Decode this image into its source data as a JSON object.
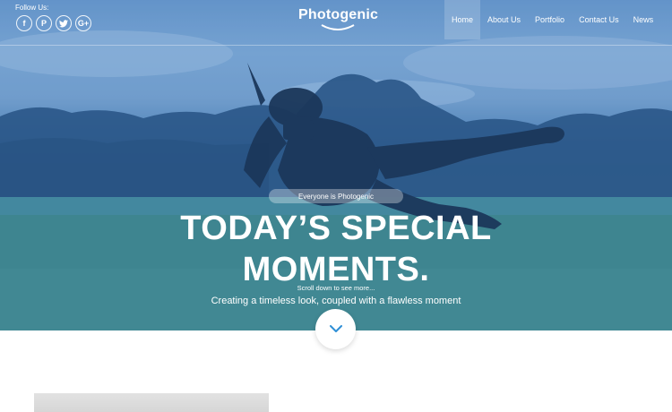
{
  "header": {
    "follow_label": "Follow Us:",
    "social": [
      {
        "glyph": "f",
        "icon": "facebook-icon"
      },
      {
        "glyph": "P",
        "icon": "pinterest-icon"
      },
      {
        "glyph": "t",
        "icon": "twitter-icon"
      },
      {
        "glyph": "G+",
        "icon": "google-plus-icon"
      }
    ],
    "brand": "Photogenic",
    "nav": [
      {
        "label": "Home",
        "active": true
      },
      {
        "label": "About Us",
        "active": false
      },
      {
        "label": "Portfolio",
        "active": false
      },
      {
        "label": "Contact Us",
        "active": false
      },
      {
        "label": "News",
        "active": false
      }
    ]
  },
  "hero": {
    "badge": "Everyone is Photogenic",
    "title_line1": "TODAY’S SPECIAL",
    "title_line2": "MOMENTS.",
    "scroll_hint": "Scroll down to see more...",
    "subtitle": "Creating a timeless look, coupled with a flawless moment",
    "down_icon": "chevron-down-icon"
  },
  "colors": {
    "accent": "#2f8fd6",
    "overlay": "#3a78be"
  }
}
